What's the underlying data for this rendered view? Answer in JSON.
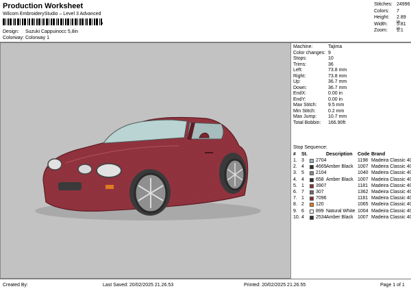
{
  "header": {
    "title": "Production Worksheet",
    "subtitle": "Wilcom EmbroideryStudio – Level 3 Advanced",
    "barcode_suffix": ",",
    "design_label": "Design:",
    "design_value": "Suzuki Cappuinocc 5,8in",
    "colorway_label": "Colorway:",
    "colorway_value": "Colorway 1"
  },
  "top_stats": [
    {
      "label": "Stitches:",
      "value": "24996"
    },
    {
      "label": "Colors:",
      "value": "7"
    },
    {
      "label": "Height:",
      "value": "2.89 in"
    },
    {
      "label": "Width:",
      "value": "5.81 in"
    },
    {
      "label": "Zoom:",
      "value": "1:1"
    }
  ],
  "machine_info": [
    {
      "label": "Machine:",
      "value": "Tajima"
    },
    {
      "label": "Color changes:",
      "value": "9"
    },
    {
      "label": "Stops:",
      "value": "10"
    },
    {
      "label": "Trims:",
      "value": "36"
    },
    {
      "label": "Left:",
      "value": "73.8 mm"
    },
    {
      "label": "Right:",
      "value": "73.8 mm"
    },
    {
      "label": "Up:",
      "value": "36.7 mm"
    },
    {
      "label": "Down:",
      "value": "36.7 mm"
    },
    {
      "label": "EndX:",
      "value": "0.00 in"
    },
    {
      "label": "EndY:",
      "value": "0.00 in"
    },
    {
      "label": "Max Stitch:",
      "value": "9.5 mm"
    },
    {
      "label": "Min Stitch:",
      "value": "0.2 mm"
    },
    {
      "label": "Max Jump:",
      "value": "10.7 mm"
    },
    {
      "label": "Total Bobbin:",
      "value": "166.90ft"
    }
  ],
  "stop_sequence": {
    "title": "Stop Sequence:",
    "headers": {
      "index": "#",
      "st": "St.",
      "description": "Description",
      "code": "Code",
      "brand": "Brand"
    },
    "rows": [
      {
        "index": "1.",
        "st": "3",
        "color": "#9fb5bf",
        "cd": "2704",
        "description": "",
        "code": "1198",
        "brand": "Madeira Classic 40"
      },
      {
        "index": "2.",
        "st": "4",
        "color": "#2f2f2f",
        "cd": "4665",
        "description": "Amber Black",
        "code": "1007",
        "brand": "Madeira Classic 40"
      },
      {
        "index": "3.",
        "st": "5",
        "color": "#8a8a8a",
        "cd": "2104",
        "description": "",
        "code": "1040",
        "brand": "Madeira Classic 40"
      },
      {
        "index": "4.",
        "st": "4",
        "color": "#2f2f2f",
        "cd": "658",
        "description": "Amber Black",
        "code": "1007",
        "brand": "Madeira Classic 40"
      },
      {
        "index": "5.",
        "st": "1",
        "color": "#8c2f3a",
        "cd": "3907",
        "description": "",
        "code": "1181",
        "brand": "Madeira Classic 40"
      },
      {
        "index": "6.",
        "st": "7",
        "color": "#6b6b6b",
        "cd": "307",
        "description": "",
        "code": "1362",
        "brand": "Madeira Classic 40"
      },
      {
        "index": "7.",
        "st": "1",
        "color": "#8c2f3a",
        "cd": "7096",
        "description": "",
        "code": "1181",
        "brand": "Madeira Classic 40"
      },
      {
        "index": "8.",
        "st": "2",
        "color": "#e07a1f",
        "cd": "120",
        "description": "",
        "code": "1065",
        "brand": "Madeira Classic 40"
      },
      {
        "index": "9.",
        "st": "6",
        "color": "#f4f4f4",
        "cd": "899",
        "description": "Natural White",
        "code": "1004",
        "brand": "Madeira Classic 40"
      },
      {
        "index": "10.",
        "st": "4",
        "color": "#2f2f2f",
        "cd": "2534",
        "description": "Amber Black",
        "code": "1007",
        "brand": "Madeira Classic 40"
      }
    ]
  },
  "footer": {
    "created_by": "Created By:",
    "last_saved": "Last Saved: 20/02/2025 21.26.53",
    "printed": "Printed: 20/02/2025 21.26.55",
    "page": "Page 1 of 1"
  },
  "colors": {
    "canvas_bg": "#c2c2c2",
    "car_body": "#8c2f3a"
  }
}
